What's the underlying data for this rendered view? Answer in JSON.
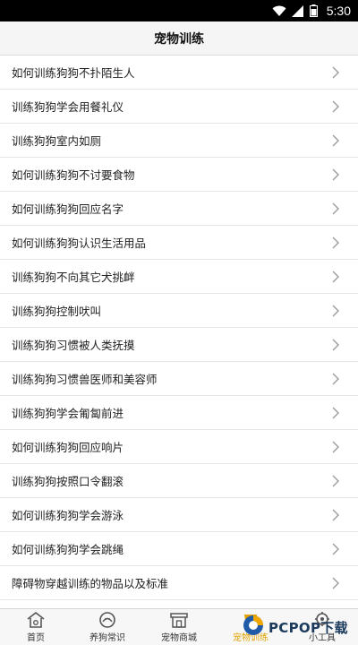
{
  "status_bar": {
    "time": "5:30",
    "icons": [
      "wifi-icon",
      "signal-icon",
      "battery-icon"
    ]
  },
  "header": {
    "title": "宠物训练"
  },
  "list": {
    "items": [
      "如何训练狗狗不扑陌生人",
      "训练狗狗学会用餐礼仪",
      "训练狗狗室内如厕",
      "如何训练狗狗不讨要食物",
      "如何训练狗狗回应名字",
      "如何训练狗狗认识生活用品",
      "训练狗狗不向其它犬挑衅",
      "训练狗狗控制吠叫",
      "训练狗狗习惯被人类抚摸",
      "训练狗狗习惯兽医师和美容师",
      "训练狗狗学会匍匐前进",
      "如何训练狗狗回应响片",
      "训练狗狗按照口令翻滚",
      "如何训练狗狗学会游泳",
      "如何训练狗狗学会跳绳",
      "障碍物穿越训练的物品以及标准"
    ],
    "chevron_icon": "chevron-right-icon"
  },
  "tab_bar": {
    "tabs": [
      {
        "label": "首页",
        "icon": "home-icon"
      },
      {
        "label": "养狗常识",
        "icon": "knowledge-icon"
      },
      {
        "label": "宠物商城",
        "icon": "shop-icon"
      },
      {
        "label": "宠物训练",
        "icon": "training-icon"
      },
      {
        "label": "小工具",
        "icon": "tools-icon"
      }
    ],
    "active_index": 3,
    "active_color": "#e0a100"
  },
  "watermark": {
    "text": "PCPOP下载"
  }
}
